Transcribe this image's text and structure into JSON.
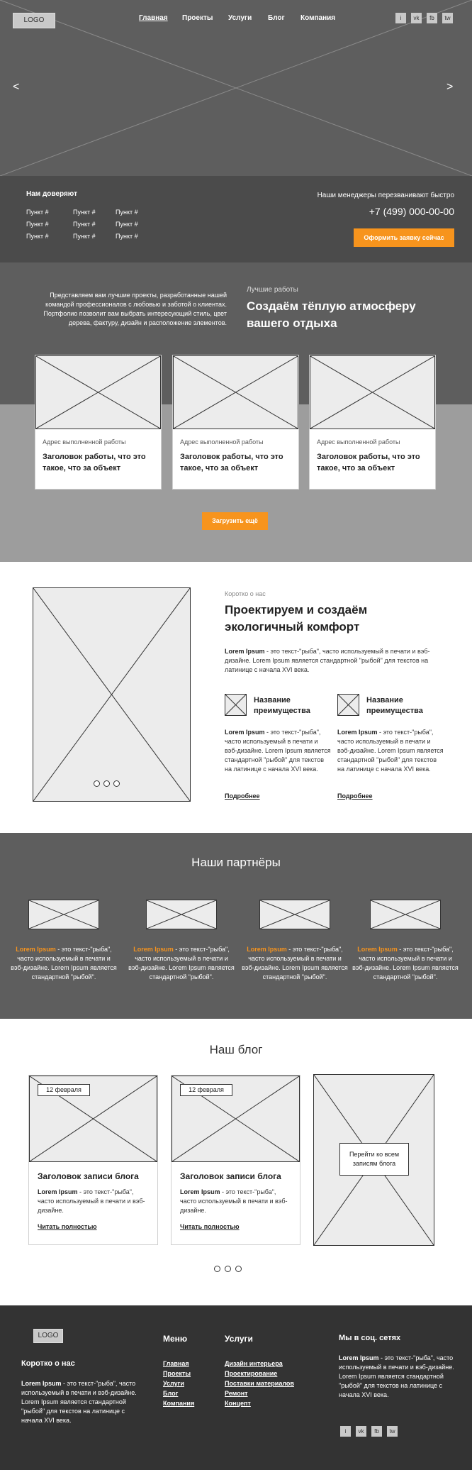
{
  "header": {
    "logo": "LOGO",
    "nav": [
      "Главная",
      "Проекты",
      "Услуги",
      "Блог",
      "Компания"
    ],
    "social": [
      "i",
      "vk",
      "fb",
      "tw"
    ],
    "prev": "<",
    "next": ">"
  },
  "trust": {
    "title": "Нам доверяют",
    "items": [
      "Пункт #",
      "Пункт #",
      "Пункт #",
      "Пункт #",
      "Пункт #",
      "Пункт #",
      "Пункт #",
      "Пункт #",
      "Пункт #"
    ],
    "callback_text": "Наши менеджеры перезванивают быстро",
    "phone": "+7 (499) 000-00-00",
    "order_button": "Оформить заявку сейчас"
  },
  "projects": {
    "intro": "Представляем вам лучшие проекты, разработанные нашей командой профессионалов с любовью и заботой о клиентах. Портфолио позволит вам выбрать интересующий стиль, цвет дерева, фактуру, дизайн и расположение элементов.",
    "label": "Лучшие работы",
    "title": "Создаём тёплую атмосферу вашего отдыха",
    "cards": [
      {
        "address": "Адрес выполненной работы",
        "title": "Заголовок работы, что это такое, что за объект"
      },
      {
        "address": "Адрес выполненной работы",
        "title": "Заголовок работы, что это такое, что за объект"
      },
      {
        "address": "Адрес выполненной работы",
        "title": "Заголовок работы, что это такое, что за объект"
      }
    ],
    "load_more": "Загрузить ещё"
  },
  "about": {
    "label": "Коротко о нас",
    "title": "Проектируем и создаём экологичный комфорт",
    "text_bold": "Lorem Ipsum",
    "text": " - это текст-\"рыба\", часто используемый в печати и вэб-дизайне. Lorem Ipsum является стандартной \"рыбой\" для текстов на латинице с начала XVI века.",
    "advantages": [
      {
        "title": "Название преимущества",
        "text_bold": "Lorem Ipsum",
        "text": " - это текст-\"рыба\", часто используемый в печати и вэб-дизайне. Lorem Ipsum является стандартной \"рыбой\" для текстов на латинице с начала XVI века.",
        "more": "Подробнее"
      },
      {
        "title": "Название преимущества",
        "text_bold": "Lorem Ipsum",
        "text": " - это текст-\"рыба\", часто используемый в печати и вэб-дизайне. Lorem Ipsum является стандартной \"рыбой\" для текстов на латинице с начала XVI века.",
        "more": "Подробнее"
      }
    ]
  },
  "partners": {
    "title": "Наши партнёры",
    "items": [
      {
        "bold": "Lorem Ipsum",
        "text": " - это текст-\"рыба\", часто используемый в печати и вэб-дизайне. Lorem Ipsum является стандартной \"рыбой\"."
      },
      {
        "bold": "Lorem Ipsum",
        "text": " - это текст-\"рыба\", часто используемый в печати и вэб-дизайне. Lorem Ipsum является стандартной \"рыбой\"."
      },
      {
        "bold": "Lorem Ipsum",
        "text": " - это текст-\"рыба\", часто используемый в печати и вэб-дизайне. Lorem Ipsum является стандартной \"рыбой\"."
      },
      {
        "bold": "Lorem Ipsum",
        "text": " - это текст-\"рыба\", часто используемый в печати и вэб-дизайне. Lorem Ipsum является стандартной \"рыбой\"."
      }
    ]
  },
  "blog": {
    "title": "Наш блог",
    "posts": [
      {
        "date": "12 февраля",
        "title": "Заголовок записи блога",
        "bold": "Lorem Ipsum",
        "text": " - это текст-\"рыба\", часто используемый в печати и вэб-дизайне.",
        "read": "Читать полностью"
      },
      {
        "date": "12 февраля",
        "title": "Заголовок записи блога",
        "bold": "Lorem Ipsum",
        "text": " - это текст-\"рыба\", часто используемый в печати и вэб-дизайне.",
        "read": "Читать полностью"
      }
    ],
    "all_posts": "Перейти ко всем записям блога"
  },
  "footer": {
    "logo": "LOGO",
    "about_title": "Коротко о нас",
    "about_bold": "Lorem Ipsum",
    "about_text": " - это текст-\"рыба\", часто используемый в печати и вэб-дизайне. Lorem Ipsum является стандартной \"рыбой\" для текстов на латинице с начала XVI века.",
    "menu_title": "Меню",
    "menu": [
      "Главная",
      "Проекты",
      "Услуги",
      "Блог",
      "Компания"
    ],
    "services_title": "Услуги",
    "services": [
      "Дизайн интерьера",
      "Проектирование",
      "Поставки материалов",
      "Ремонт",
      "Концепт"
    ],
    "social_title": "Мы в соц. сетях",
    "social_bold": "Lorem Ipsum",
    "social_text": " - это текст-\"рыба\", часто используемый в печати и вэб-дизайне. Lorem Ipsum является стандартной \"рыбой\" для текстов на латинице с начала XVI века.",
    "social": [
      "i",
      "vk",
      "fb",
      "tw"
    ]
  },
  "colors": {
    "accent": "#f7941d",
    "dark": "#5e5e5e",
    "darker": "#4b4b4b",
    "footer": "#333333"
  }
}
